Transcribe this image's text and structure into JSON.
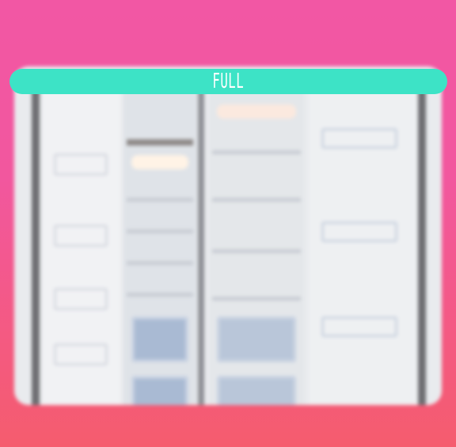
{
  "banner": {
    "label": "FULL",
    "color": "#3de3c6"
  },
  "background": {
    "top_color": "#f257a4",
    "bottom_color": "#f55c6e"
  },
  "scene": {
    "subject": "open-refrigerator-photo",
    "blurred": true
  }
}
